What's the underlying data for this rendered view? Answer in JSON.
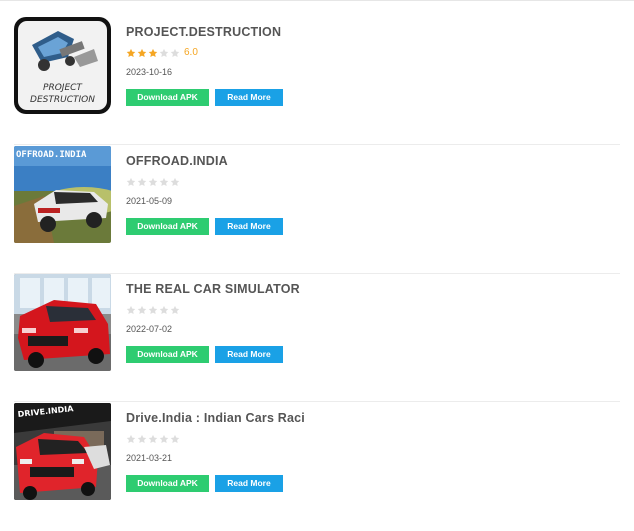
{
  "apps": [
    {
      "title": "PROJECT.DESTRUCTION",
      "rating_value": 3,
      "rating_max": 5,
      "rating_text": "6.0",
      "date": "2023-10-16",
      "download_label": "Download APK",
      "read_more_label": "Read More",
      "thumb_icon": "project-destruction-logo-icon",
      "thumb_text": [
        "PROJECT",
        "DESTRUCTION"
      ]
    },
    {
      "title": "OFFROAD.INDIA",
      "rating_value": 0,
      "rating_max": 5,
      "rating_text": "",
      "date": "2021-05-09",
      "download_label": "Download APK",
      "read_more_label": "Read More",
      "thumb_icon": "offroad-india-car-icon",
      "thumb_text": [
        "OFFROAD.INDIA"
      ]
    },
    {
      "title": "THE REAL CAR SIMULATOR",
      "rating_value": 0,
      "rating_max": 5,
      "rating_text": "",
      "date": "2022-07-02",
      "download_label": "Download APK",
      "read_more_label": "Read More",
      "thumb_icon": "red-car-simulator-icon",
      "thumb_text": []
    },
    {
      "title": "Drive.India : Indian Cars Raci",
      "rating_value": 0,
      "rating_max": 5,
      "rating_text": "",
      "date": "2021-03-21",
      "download_label": "Download APK",
      "read_more_label": "Read More",
      "thumb_icon": "drive-india-car-icon",
      "thumb_text": [
        "DRIVE.INDIA"
      ]
    }
  ],
  "colors": {
    "download": "#2ecc71",
    "read_more": "#1aa1e6",
    "star_on": "#f5a623",
    "star_off": "#dddddd"
  }
}
